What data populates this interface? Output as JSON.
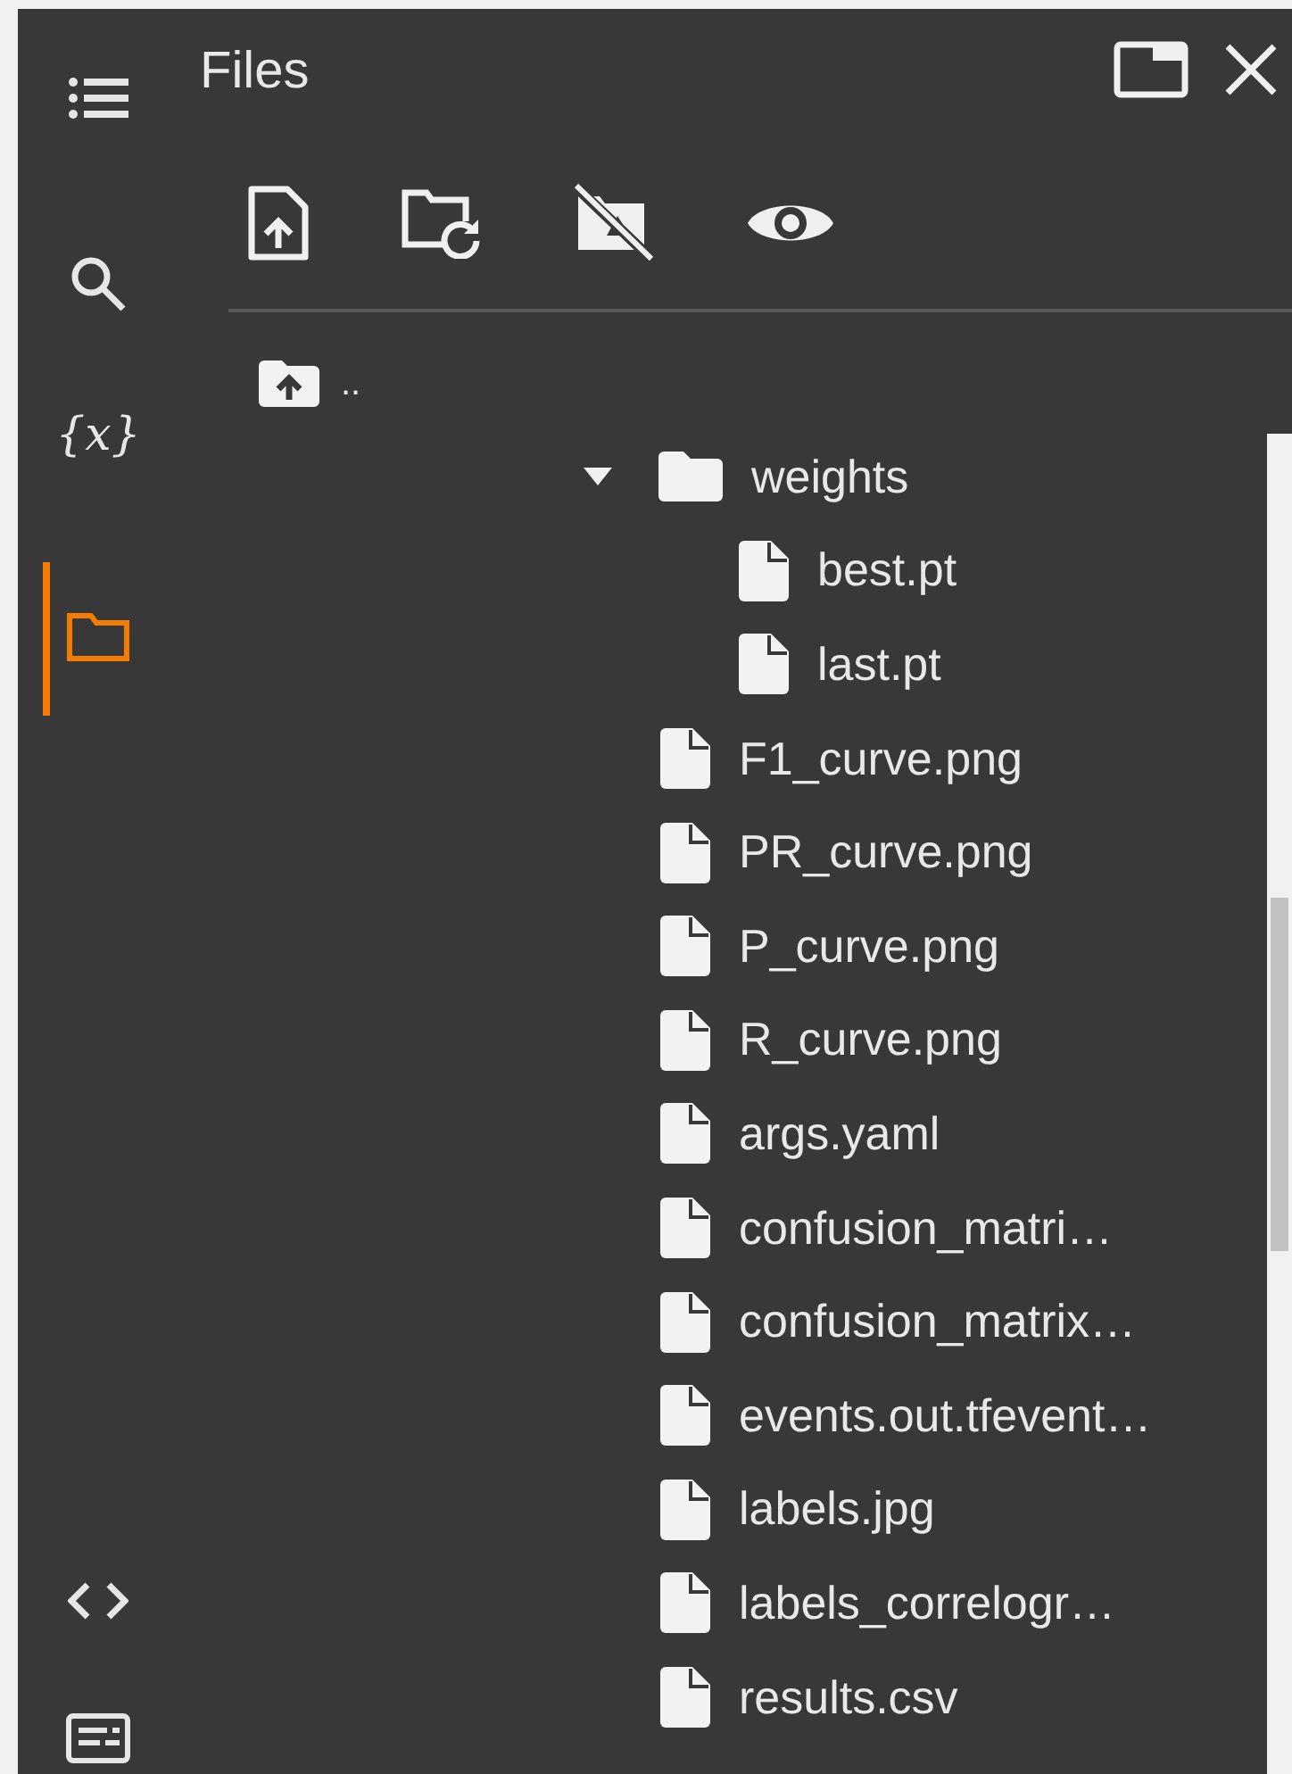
{
  "rail": {
    "top": [
      {
        "kind": "toc",
        "selected": false
      },
      {
        "kind": "search",
        "selected": false
      },
      {
        "kind": "variables",
        "label": "{x}",
        "selected": false
      },
      {
        "kind": "files",
        "selected": true
      }
    ],
    "bottom": [
      {
        "kind": "code",
        "selected": false
      },
      {
        "kind": "terminal",
        "selected": false
      }
    ]
  },
  "panel": {
    "title": "Files",
    "toolbar": [
      {
        "kind": "upload"
      },
      {
        "kind": "refresh"
      },
      {
        "kind": "drive"
      },
      {
        "kind": "eye"
      }
    ]
  },
  "parent": {
    "label": ".."
  },
  "tree": [
    {
      "name": "weights",
      "kind": "folder",
      "expanded": true,
      "children": [
        {
          "name": "best.pt",
          "kind": "file"
        },
        {
          "name": "last.pt",
          "kind": "file"
        }
      ]
    },
    {
      "name": "F1_curve.png",
      "kind": "file"
    },
    {
      "name": "PR_curve.png",
      "kind": "file"
    },
    {
      "name": "P_curve.png",
      "kind": "file"
    },
    {
      "name": "R_curve.png",
      "kind": "file"
    },
    {
      "name": "args.yaml",
      "kind": "file"
    },
    {
      "name": "confusion_matri…",
      "kind": "file"
    },
    {
      "name": "confusion_matrix…",
      "kind": "file"
    },
    {
      "name": "events.out.tfevent…",
      "kind": "file"
    },
    {
      "name": "labels.jpg",
      "kind": "file"
    },
    {
      "name": "labels_correlogr…",
      "kind": "file"
    },
    {
      "name": "results.csv",
      "kind": "file"
    }
  ]
}
